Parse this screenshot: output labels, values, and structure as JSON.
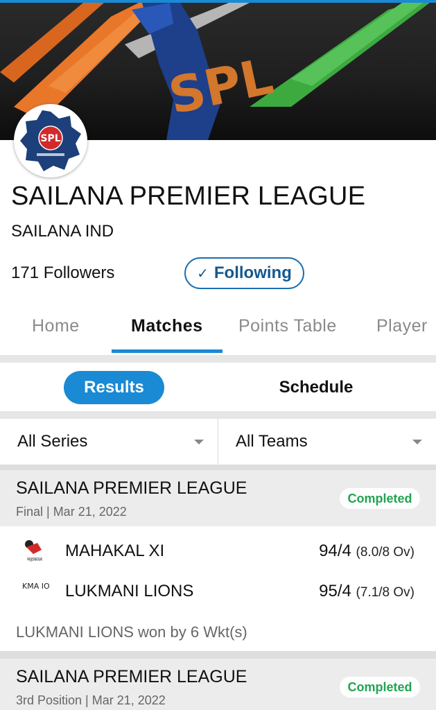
{
  "banner": {
    "logo_text": "SPL"
  },
  "league": {
    "logo_text": "SPL",
    "title": "SAILANA PREMIER LEAGUE",
    "location": "SAILANA IND",
    "followers": "171 Followers",
    "follow_label": "Following",
    "follow_icon": "check-icon"
  },
  "tabs": [
    {
      "label": "Home"
    },
    {
      "label": "Matches"
    },
    {
      "label": "Points Table"
    },
    {
      "label": "Player"
    }
  ],
  "active_tab": "Matches",
  "toggle": {
    "results": "Results",
    "schedule": "Schedule",
    "selected": "Results"
  },
  "filters": {
    "series": "All Series",
    "teams": "All Teams"
  },
  "matches": [
    {
      "title": "SAILANA PREMIER LEAGUE",
      "meta": "Final | Mar 21, 2022",
      "status": "Completed",
      "teams": [
        {
          "name": "MAHAKAL XI",
          "logo_text": "महाकाल",
          "score": "94/4",
          "overs": "(8.0/8 Ov)"
        },
        {
          "name": "LUKMANI LIONS",
          "logo_text": "KMA ION",
          "score": "95/4",
          "overs": "(7.1/8 Ov)"
        }
      ],
      "result": "LUKMANI LIONS won by 6 Wkt(s)"
    },
    {
      "title": "SAILANA PREMIER LEAGUE",
      "meta": "3rd Position | Mar 21, 2022",
      "status": "Completed"
    }
  ],
  "colors": {
    "accent": "#1a8ad4",
    "follow": "#14598f",
    "completed": "#21a451"
  }
}
